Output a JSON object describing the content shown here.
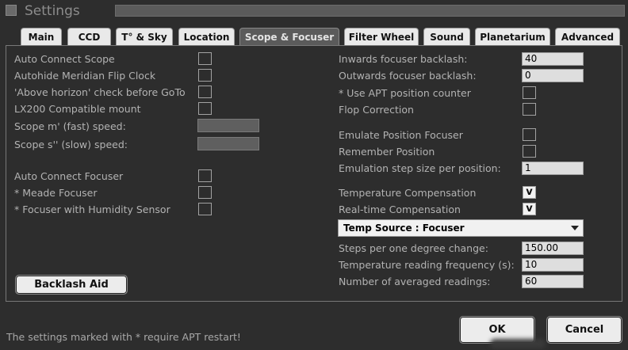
{
  "window": {
    "title": "Settings"
  },
  "tabs": [
    {
      "label": "Main"
    },
    {
      "label": "CCD"
    },
    {
      "label": "T° & Sky"
    },
    {
      "label": "Location"
    },
    {
      "label": "Scope & Focuser",
      "active": true
    },
    {
      "label": "Filter Wheel"
    },
    {
      "label": "Sound"
    },
    {
      "label": "Planetarium"
    },
    {
      "label": "Advanced"
    }
  ],
  "scope": {
    "auto_connect": {
      "label": "Auto Connect Scope",
      "checked": false
    },
    "autohide_flip": {
      "label": "Autohide Meridian Flip Clock",
      "checked": false
    },
    "above_horizon": {
      "label": "'Above horizon' check before GoTo",
      "checked": false
    },
    "lx200": {
      "label": "LX200 Compatible mount",
      "checked": false
    },
    "fast_speed": {
      "label": "Scope m' (fast) speed:",
      "value": ""
    },
    "slow_speed": {
      "label": "Scope s'' (slow) speed:",
      "value": ""
    }
  },
  "focuser_left": {
    "auto_connect": {
      "label": "Auto Connect Focuser",
      "checked": false
    },
    "meade": {
      "label": "* Meade Focuser",
      "checked": false
    },
    "humidity": {
      "label": "* Focuser with Humidity Sensor",
      "checked": false
    }
  },
  "backlash_aid_button": "Backlash Aid",
  "focuser_right": {
    "inwards_backlash": {
      "label": "Inwards focuser backlash:",
      "value": "40"
    },
    "outwards_backlash": {
      "label": "Outwards focuser backlash:",
      "value": "0"
    },
    "apt_counter": {
      "label": "* Use APT position counter",
      "checked": false
    },
    "flop": {
      "label": "Flop Correction",
      "checked": false
    },
    "emulate": {
      "label": "Emulate Position Focuser",
      "checked": false
    },
    "remember": {
      "label": "Remember Position",
      "checked": false
    },
    "step_size": {
      "label": "Emulation step size per position:",
      "value": "1"
    },
    "temp_comp": {
      "label": "Temperature Compensation",
      "checked": true,
      "mark": "v"
    },
    "realtime_comp": {
      "label": "Real-time Compensation",
      "checked": true,
      "mark": "v"
    },
    "temp_source": {
      "value": "Temp Source : Focuser"
    },
    "steps_per_degree": {
      "label": "Steps per one degree change:",
      "value": "150.00"
    },
    "reading_freq": {
      "label": "Temperature reading frequency (s):",
      "value": "10"
    },
    "averaged": {
      "label": "Number of averaged readings:",
      "value": "60"
    }
  },
  "footer": {
    "note": "The settings marked with * require APT restart!",
    "ok": "OK",
    "cancel": "Cancel"
  }
}
